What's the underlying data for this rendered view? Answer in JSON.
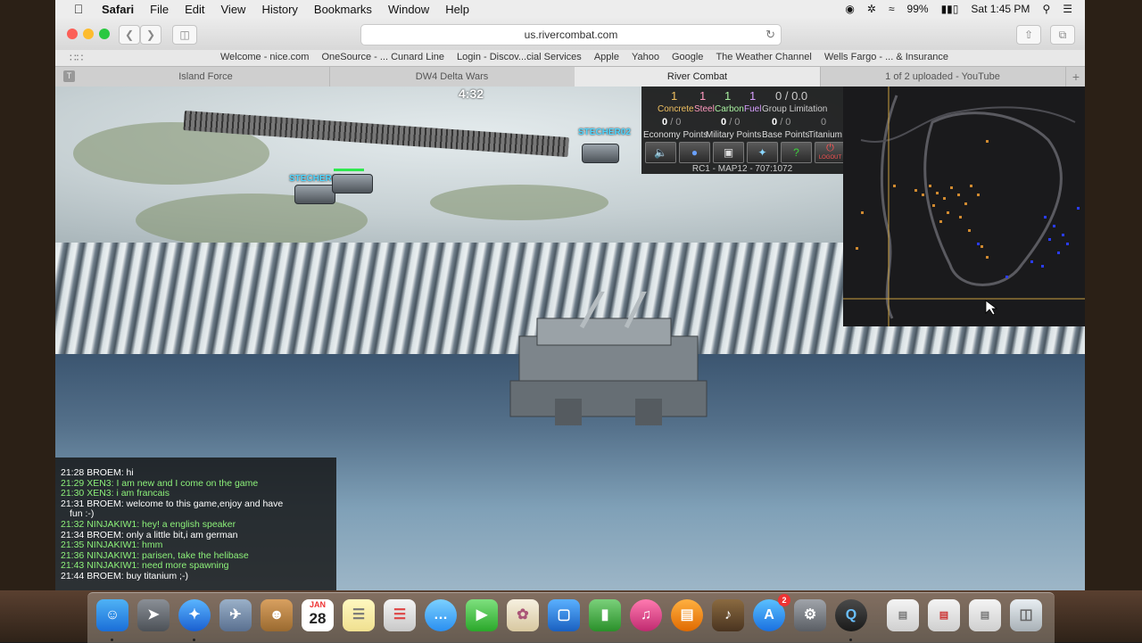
{
  "menubar": {
    "app_name": "Safari",
    "items": [
      "File",
      "Edit",
      "View",
      "History",
      "Bookmarks",
      "Window",
      "Help"
    ],
    "battery": "99%",
    "clock": "Sat 1:45 PM"
  },
  "toolbar": {
    "url": "us.rivercombat.com"
  },
  "favorites": [
    "Welcome - nice.com",
    "OneSource - ... Cunard Line",
    "Login - Discov...cial Services",
    "Apple",
    "Yahoo",
    "Google",
    "The Weather Channel",
    "Wells Fargo - ... & Insurance"
  ],
  "tabs": [
    "Island Force",
    "DW4 Delta Wars",
    "River Combat",
    "1 of 2 uploaded - YouTube"
  ],
  "game": {
    "timer": "4:32",
    "units": [
      "STECHER02",
      "STECHER02"
    ],
    "resources": {
      "concrete": "1",
      "steel": "1",
      "carbon": "1",
      "fuel": "1",
      "group_limit": "0 / 0.0",
      "labels": [
        "Concrete",
        "Steel",
        "Carbon",
        "Fuel",
        "Group Limitation"
      ],
      "economy": {
        "value": "0",
        "max": "/ 0"
      },
      "military": {
        "value": "0",
        "max": "/ 0"
      },
      "base": {
        "value": "0",
        "max": "/ 0"
      },
      "titanium": "0",
      "labels2": [
        "Economy Points",
        "Military Points",
        "Base Points",
        "Titanium"
      ],
      "logout": "LOGOUT",
      "map_info": "RC1 - MAP12 - 707:1072"
    },
    "chat": [
      {
        "text": "21:28 BROEM: hi",
        "color": "white"
      },
      {
        "text": "21:29 XEN3: I am new and I come on the game",
        "color": "green"
      },
      {
        "text": "21:30 XEN3: i am francais",
        "color": "green"
      },
      {
        "text": "21:31 BROEM: welcome to this game,enjoy and have",
        "color": "white"
      },
      {
        "text": "fun :-)",
        "color": "white",
        "cont": true
      },
      {
        "text": "21:32 NINJAKIW1: hey! a english speaker",
        "color": "green"
      },
      {
        "text": "21:34 BROEM: only a little bit,i am german",
        "color": "white"
      },
      {
        "text": "21:35 NINJAKIW1: hmm",
        "color": "green"
      },
      {
        "text": "21:36 NINJAKIW1: parisen, take the helibase",
        "color": "green"
      },
      {
        "text": "21:43 NINJAKIW1: need more spawning",
        "color": "green"
      },
      {
        "text": "21:44 BROEM: buy titanium ;-)",
        "color": "white"
      }
    ]
  },
  "dock": {
    "calendar_month": "JAN",
    "calendar_day": "28",
    "appstore_badge": "2"
  },
  "colors": {
    "chat_green": "#8df27a",
    "unit_label": "#4fd6ff",
    "concrete": "#f0c060",
    "steel": "#ff9ac0",
    "carbon": "#a8f0a0",
    "fuel": "#d8a0ff"
  }
}
